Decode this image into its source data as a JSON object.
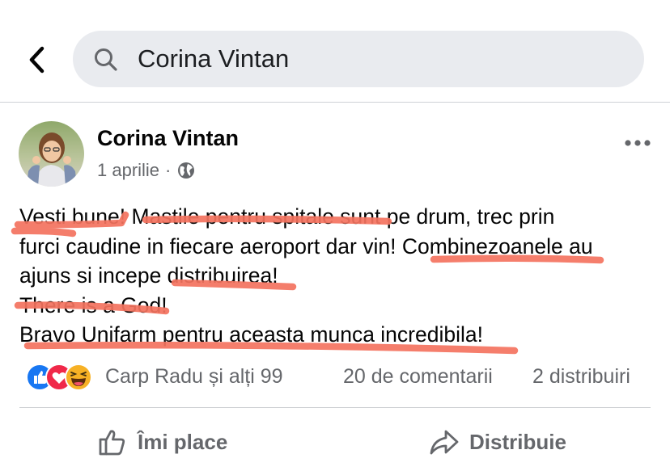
{
  "search": {
    "query": "Corina Vintan"
  },
  "post": {
    "author": "Corina Vintan",
    "date": "1 aprilie",
    "separator": "·",
    "lines": [
      "Vesti bune! Mastile pentru spitale sunt pe drum, trec prin",
      "furci caudine in fiecare aeroport dar vin! Combinezoanele au",
      "ajuns si incepe distribuirea!",
      "There is a God!",
      "Bravo Unifarm pentru aceasta munca incredibila!"
    ],
    "highlight_color": "#f4735f"
  },
  "reactions": {
    "types": [
      "like-reaction-icon",
      "love-reaction-icon",
      "haha-reaction-icon"
    ],
    "names": "Carp Radu și alți 99",
    "comments": "20 de comentarii",
    "shares": "2 distribuiri"
  },
  "actions": {
    "like_label": "Îmi place",
    "share_label": "Distribuie"
  },
  "colors": {
    "like_blue": "#1877f2",
    "love_red": "#f02849",
    "haha_yellow": "#f7b125",
    "secondary_text": "#65676b"
  }
}
